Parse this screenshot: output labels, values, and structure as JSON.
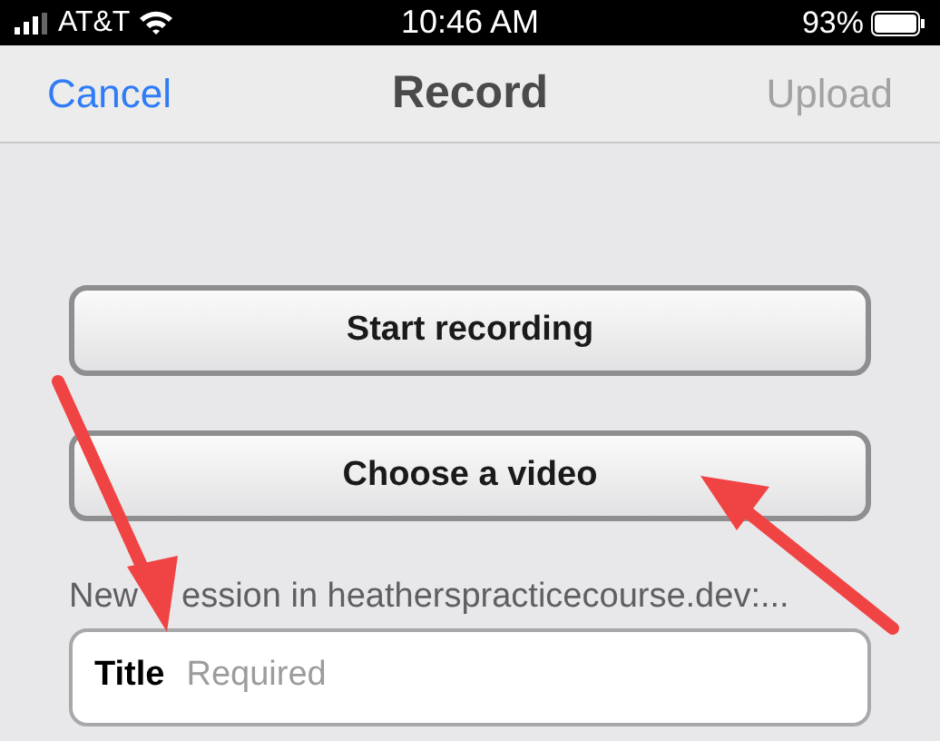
{
  "status_bar": {
    "carrier": "AT&T",
    "time": "10:46 AM",
    "battery": "93%"
  },
  "nav_bar": {
    "cancel": {
      "label": "Cancel",
      "disabled": false
    },
    "title": "Record",
    "upload": {
      "label": "Upload",
      "disabled": true
    }
  },
  "buttons": [
    {
      "label": "Start recording"
    },
    {
      "label": "Choose a video"
    }
  ],
  "caption": [
    "New",
    "ession in heatherspracticecourse.dev:..."
  ],
  "title_field": {
    "label": "Title",
    "placeholder": "Required"
  }
}
